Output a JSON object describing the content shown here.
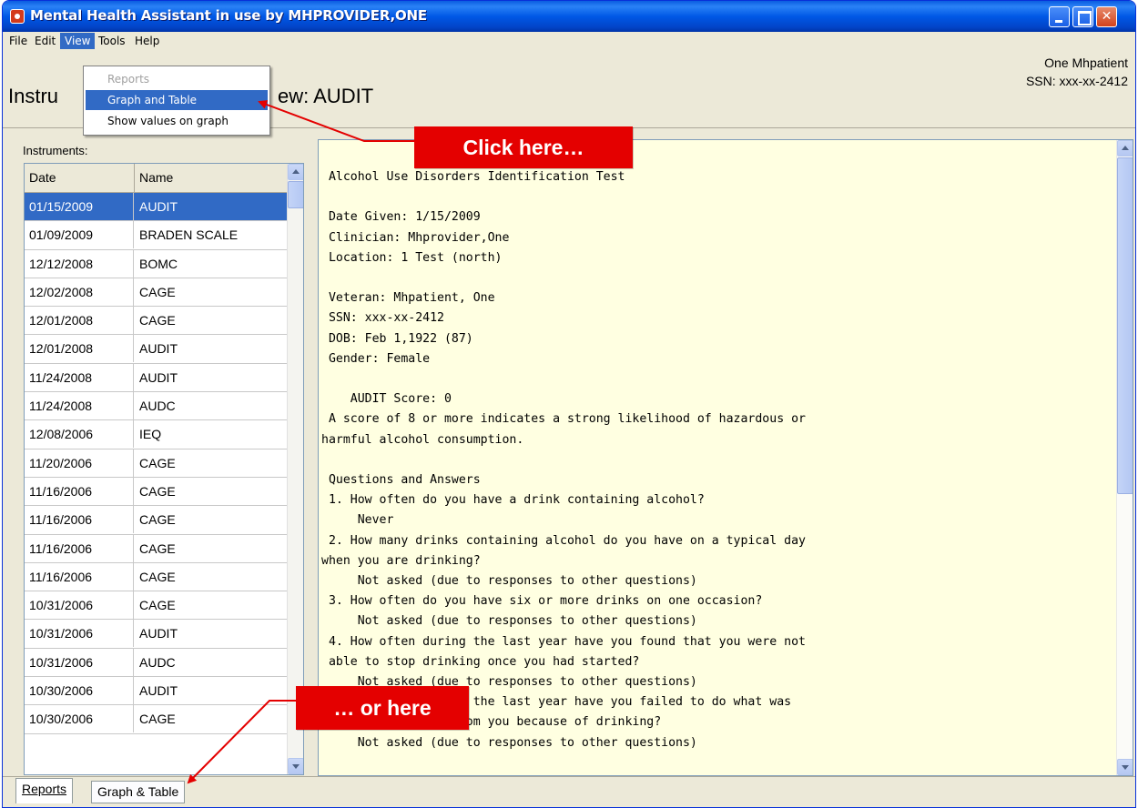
{
  "window": {
    "title": "Mental Health Assistant in use by MHPROVIDER,ONE"
  },
  "menubar": {
    "items": [
      "File",
      "Edit",
      "View",
      "Tools",
      "Help"
    ]
  },
  "view_menu": {
    "items": [
      "Reports",
      "Graph and Table",
      "Show values on graph"
    ]
  },
  "header": {
    "title_prefix": "Instru",
    "title_suffix": "ew: AUDIT",
    "patient_name": "One Mhpatient",
    "patient_ssn": "SSN: xxx-xx-2412"
  },
  "instruments": {
    "label": "Instruments:",
    "columns": [
      "Date",
      "Name"
    ],
    "rows": [
      [
        "01/15/2009",
        "AUDIT"
      ],
      [
        "01/09/2009",
        "BRADEN SCALE"
      ],
      [
        "12/12/2008",
        "BOMC"
      ],
      [
        "12/02/2008",
        "CAGE"
      ],
      [
        "12/01/2008",
        "CAGE"
      ],
      [
        "12/01/2008",
        "AUDIT"
      ],
      [
        "11/24/2008",
        "AUDIT"
      ],
      [
        "11/24/2008",
        "AUDC"
      ],
      [
        "12/08/2006",
        "IEQ"
      ],
      [
        "11/20/2006",
        "CAGE"
      ],
      [
        "11/16/2006",
        "CAGE"
      ],
      [
        "11/16/2006",
        "CAGE"
      ],
      [
        "11/16/2006",
        "CAGE"
      ],
      [
        "11/16/2006",
        "CAGE"
      ],
      [
        "10/31/2006",
        "CAGE"
      ],
      [
        "10/31/2006",
        "AUDIT"
      ],
      [
        "10/31/2006",
        "AUDC"
      ],
      [
        "10/30/2006",
        "AUDIT"
      ],
      [
        "10/30/2006",
        "CAGE"
      ]
    ],
    "selected_index": 0
  },
  "report": {
    "lines": [
      " Alcohol Use Disorders Identification Test",
      "",
      " Date Given: 1/15/2009",
      " Clinician: Mhprovider,One",
      " Location: 1 Test (north)",
      "",
      " Veteran: Mhpatient, One",
      " SSN: xxx-xx-2412",
      " DOB: Feb 1,1922 (87)",
      " Gender: Female",
      "",
      "    AUDIT Score: 0",
      " A score of 8 or more indicates a strong likelihood of hazardous or",
      "harmful alcohol consumption.",
      "",
      " Questions and Answers",
      " 1. How often do you have a drink containing alcohol?",
      "     Never",
      " 2. How many drinks containing alcohol do you have on a typical day",
      "when you are drinking?",
      "     Not asked (due to responses to other questions)",
      " 3. How often do you have six or more drinks on one occasion?",
      "     Not asked (due to responses to other questions)",
      " 4. How often during the last year have you found that you were not",
      " able to stop drinking once you had started?",
      "     Not asked (due to responses to other questions)",
      " 5. How often during the last year have you failed to do what was",
      "normally expected from you because of drinking?",
      "     Not asked (due to responses to other questions)"
    ]
  },
  "tabs": [
    "Reports",
    "Graph & Table"
  ],
  "callouts": {
    "top": "Click here…",
    "bottom": "… or here"
  },
  "colors": {
    "callout": "#e40000",
    "selection": "#316ac5",
    "report_bg": "#ffffe1"
  }
}
